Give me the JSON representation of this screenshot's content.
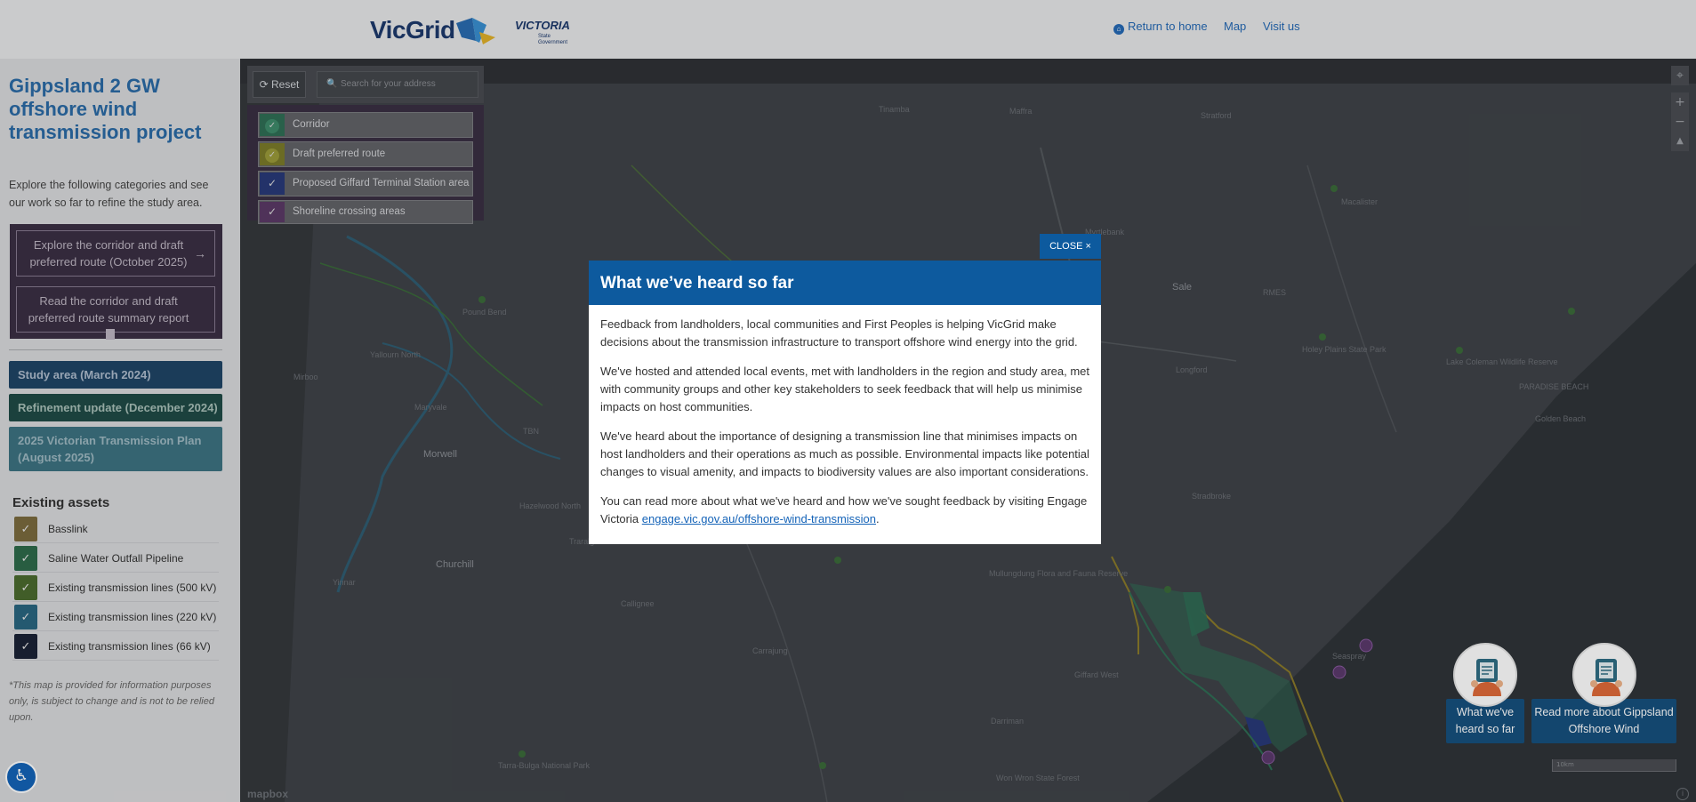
{
  "header": {
    "logo_text": "VicGrid",
    "victoria_logo_text": "VICTORIA",
    "victoria_logo_sub": "State Government",
    "nav": {
      "home": "Return to home",
      "map": "Map",
      "visit": "Visit us"
    }
  },
  "sidebar": {
    "title": "Gippsland 2 GW offshore wind transmission project",
    "intro": "Explore the following categories and see our work so far to refine the study area.",
    "explore_button": "Explore the corridor and draft preferred route (October 2025)",
    "report_button": "Read the corridor and draft preferred route summary report",
    "categories": [
      "Study area (March 2024)",
      "Refinement update (December 2024)",
      "2025 Victorian Transmission Plan (August 2025)"
    ],
    "assets_title": "Existing assets",
    "assets": [
      {
        "label": "Basslink",
        "color": "#7a6a3e"
      },
      {
        "label": "Saline Water Outfall Pipeline",
        "color": "#2e6a4a"
      },
      {
        "label": "Existing transmission lines (500 kV)",
        "color": "#4a6a2e"
      },
      {
        "label": "Existing transmission lines (220 kV)",
        "color": "#2a6680"
      },
      {
        "label": "Existing transmission lines (66 kV)",
        "color": "#1b2336"
      }
    ],
    "disclaimer": "*This map is provided for information purposes only, is subject to change and is not to be relied upon."
  },
  "map": {
    "reset_label": "Reset",
    "search_placeholder": "Search for your address",
    "layers": [
      {
        "label": "Corridor",
        "color": "#2f6e55"
      },
      {
        "label": "Draft preferred route",
        "color": "#7a7a2a"
      },
      {
        "label": "Proposed Giffard Terminal Station area",
        "color": "#283a78"
      },
      {
        "label": "Shoreline crossing areas",
        "color": "#5a3a66"
      }
    ],
    "places": {
      "morwell": "Morwell",
      "churchill": "Churchill",
      "yallourn": "Yallourn North",
      "maryvale": "Maryvale",
      "hazelwood": "Hazelwood North",
      "traralgon": "Traralgon",
      "sale": "Sale",
      "stratford": "Stratford",
      "maffra": "Maffra",
      "tinamba": "Tinamba",
      "longford": "Longford",
      "stradbroke": "Stradbroke",
      "yinnar": "Yinnar",
      "callignee": "Callignee",
      "carrajung": "Carrajung",
      "darriman": "Darriman",
      "giffard": "Giffard West",
      "seaspray": "Seaspray",
      "paradise": "PARADISE BEACH",
      "golden": "Golden Beach",
      "mirboo": "Mirboo",
      "rmes": "RMES",
      "tbn": "TBN",
      "myrtlebank": "Myrtlebank",
      "lake_coleman": "Lake Coleman Wildlife Reserve",
      "macalister": "Macalister",
      "holey_plains": "Holey Plains State Park",
      "mullungdung": "Mullungdung Flora and Fauna Reserve",
      "won_wron": "Won Wron State Forest",
      "tarra": "Tarra-Bulga National Park",
      "pound": "Pound Bend"
    },
    "mapbox_label": "mapbox",
    "scale_label": "10km",
    "zoom_in": "+",
    "zoom_out": "−"
  },
  "cards": {
    "heard": "What we've heard so far",
    "read_more": "Read more about Gippsland Offshore Wind"
  },
  "modal": {
    "close_label": "CLOSE ×",
    "title": "What we’ve heard so far",
    "p1": "Feedback from landholders, local communities and First Peoples is helping VicGrid make decisions about the transmission infrastructure to transport offshore wind energy into the grid.",
    "p2": "We've hosted and attended local events, met with landholders in the region and study area, met with community groups and other key stakeholders to seek feedback that will help us minimise impacts on host communities.",
    "p3": "We've heard about the importance of designing a transmission line that minimises impacts on host landholders and their operations as much as possible. Environmental impacts like potential changes to visual amenity, and impacts to biodiversity values are also important considerations.",
    "p4_prefix": "You can read more about what we've heard and how we've sought feedback by visiting Engage Victoria",
    "p4_link": "engage.vic.gov.au/offshore-wind-transmission",
    "p4_suffix": "."
  },
  "colors": {
    "header_bg": "#e6e7e9",
    "brand_blue": "#0d5a9e",
    "link_blue": "#2569b4",
    "map_bg": "#3f4348"
  }
}
